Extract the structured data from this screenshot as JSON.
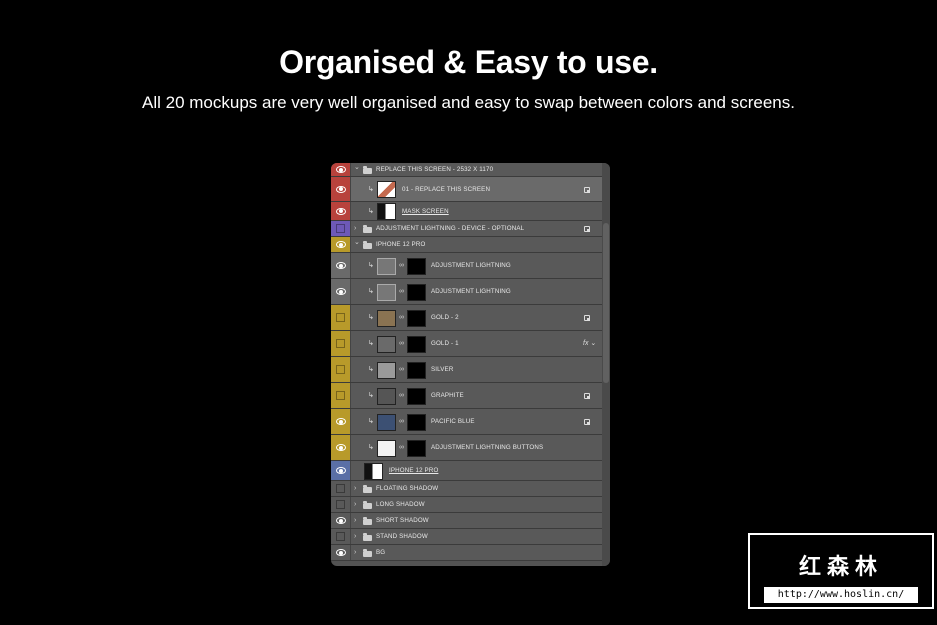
{
  "headline": "Organised & Easy to use.",
  "subline": "All 20 mockups are very well organised and easy to swap between colors and screens.",
  "layers": [
    {
      "label": "REPLACE THIS SCREEN - 2532 X 1170",
      "type": "group",
      "expanded": true,
      "eye": true,
      "color": "#b8423c",
      "indent": 0,
      "underline": false
    },
    {
      "label": "01 - REPLACE THIS SCREEN",
      "type": "smart",
      "eye": true,
      "color": "#b8423c",
      "indent": 1,
      "underline": false,
      "badge": "smart-object",
      "selected": true
    },
    {
      "label": "MASK SCREEN",
      "type": "pixel",
      "eye": true,
      "color": "#b8423c",
      "indent": 1,
      "underline": true
    },
    {
      "label": "ADJUSTMENT LIGHTNING - DEVICE - OPTIONAL",
      "type": "group",
      "expanded": false,
      "eye": false,
      "color": "#6d59b8",
      "indent": 0,
      "underline": false,
      "badge": "smart-object"
    },
    {
      "label": "IPHONE 12 PRO",
      "type": "group",
      "expanded": true,
      "eye": true,
      "color": "#b89a2a",
      "indent": 0,
      "underline": false
    },
    {
      "label": "ADJUSTMENT LIGHTNING",
      "type": "adjust",
      "eye": true,
      "color": "#6a6a6a",
      "indent": 1,
      "underline": false
    },
    {
      "label": "ADJUSTMENT LIGHTNING",
      "type": "adjust",
      "eye": true,
      "color": "#6a6a6a",
      "indent": 1,
      "underline": false
    },
    {
      "label": "GOLD - 2",
      "type": "fill",
      "fill": "#8a7352",
      "eye": false,
      "color": "#b89a2a",
      "indent": 1,
      "underline": false,
      "badge": "smart-object"
    },
    {
      "label": "GOLD - 1",
      "type": "camera",
      "eye": false,
      "color": "#b89a2a",
      "indent": 1,
      "underline": false,
      "badge": "fx"
    },
    {
      "label": "SILVER",
      "type": "fill",
      "fill": "#9a9a9a",
      "eye": false,
      "color": "#b89a2a",
      "indent": 1,
      "underline": false
    },
    {
      "label": "GRAPHITE",
      "type": "fill",
      "fill": "#555555",
      "eye": false,
      "color": "#b89a2a",
      "indent": 1,
      "underline": false,
      "badge": "smart-object"
    },
    {
      "label": "PACIFIC BLUE",
      "type": "fill",
      "fill": "#3c5073",
      "eye": true,
      "color": "#b89a2a",
      "indent": 1,
      "underline": false,
      "badge": "smart-object"
    },
    {
      "label": "ADJUSTMENT LIGHTNING BUTTONS",
      "type": "fill",
      "fill": "#f2f2f2",
      "eye": true,
      "color": "#b89a2a",
      "indent": 1,
      "underline": false
    },
    {
      "label": "IPHONE 12 PRO",
      "type": "pixel",
      "eye": true,
      "color": "#5a6fa6",
      "indent": 0,
      "underline": true
    },
    {
      "label": "FLOATING SHADOW",
      "type": "group",
      "expanded": false,
      "eye": false,
      "color": "#595959",
      "indent": 0,
      "underline": false
    },
    {
      "label": "LONG SHADOW",
      "type": "group",
      "expanded": false,
      "eye": false,
      "color": "#595959",
      "indent": 0,
      "underline": false
    },
    {
      "label": "SHORT SHADOW",
      "type": "group",
      "expanded": false,
      "eye": true,
      "color": "#595959",
      "indent": 0,
      "underline": false
    },
    {
      "label": "STAND SHADOW",
      "type": "group",
      "expanded": false,
      "eye": false,
      "color": "#595959",
      "indent": 0,
      "underline": false
    },
    {
      "label": "BG",
      "type": "group",
      "expanded": false,
      "eye": true,
      "color": "#595959",
      "indent": 0,
      "underline": false
    }
  ],
  "watermark": {
    "title": "红森林",
    "url": "http://www.hoslin.cn/"
  }
}
